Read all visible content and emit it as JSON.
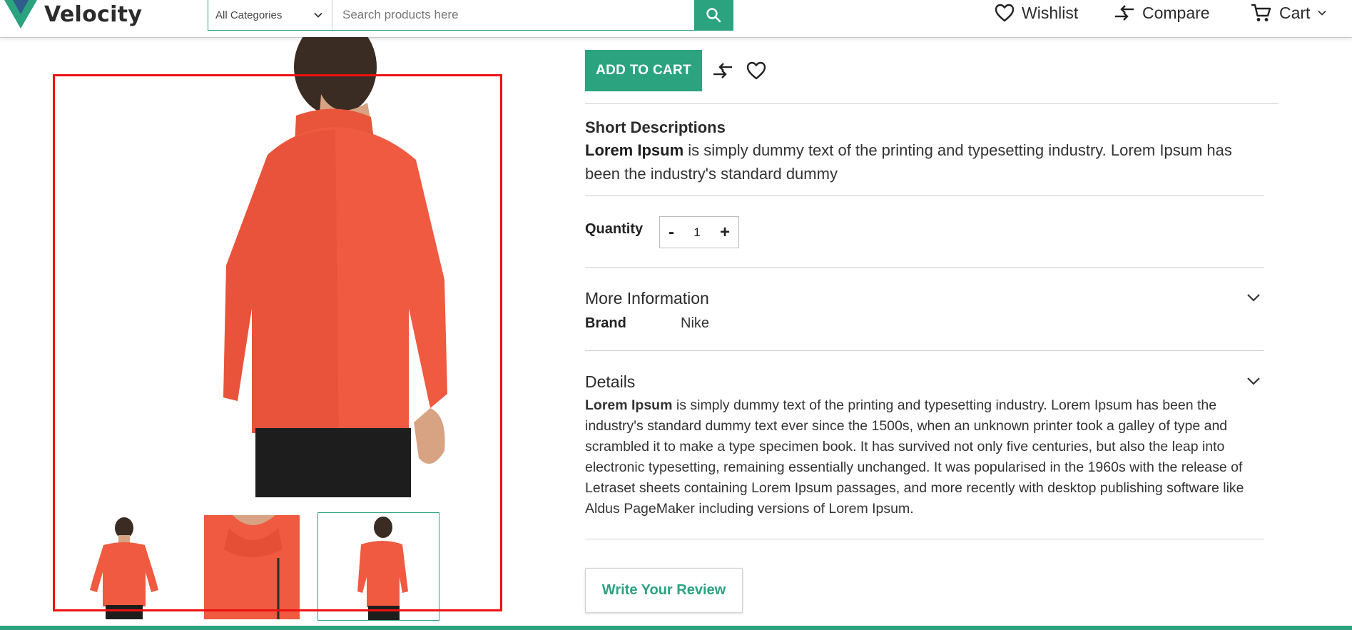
{
  "brand": {
    "name": "Velocity",
    "accent_color": "#2aa37e",
    "logo_icon": "velocity-v-logo"
  },
  "search": {
    "category_selected": "All Categories",
    "placeholder": "Search products here",
    "button_icon": "search-icon"
  },
  "header_links": {
    "wishlist": "Wishlist",
    "compare": "Compare",
    "cart": "Cart"
  },
  "gallery": {
    "main_image_alt": "Orange quarter-zip pullover, back view",
    "thumbnails": [
      "front view",
      "collar detail",
      "back view"
    ],
    "active_thumbnail_index": 2,
    "highlight_color": "#ee1111"
  },
  "actions": {
    "add_to_cart": "ADD TO CART",
    "compare_icon": "compare-arrows-icon",
    "wishlist_icon": "heart-icon"
  },
  "short_description": {
    "title": "Short Descriptions",
    "lead": "Lorem Ipsum",
    "text": " is simply dummy text of the printing and typesetting industry. Lorem Ipsum has been the industry's standard dummy"
  },
  "quantity": {
    "label": "Quantity",
    "minus": "-",
    "value": "1",
    "plus": "+"
  },
  "more_information": {
    "title": "More Information",
    "brand_label": "Brand",
    "brand_value": "Nike"
  },
  "details": {
    "title": "Details",
    "lead": "Lorem Ipsum",
    "text": " is simply dummy text of the printing and typesetting industry. Lorem Ipsum has been the industry's standard dummy text ever since the 1500s, when an unknown printer took a galley of type and scrambled it to make a type specimen book. It has survived not only five centuries, but also the leap into electronic typesetting, remaining essentially unchanged. It was popularised in the 1960s with the release of Letraset sheets containing Lorem Ipsum passages, and more recently with desktop publishing software like Aldus PageMaker including versions of Lorem Ipsum."
  },
  "review": {
    "button": "Write Your Review"
  }
}
